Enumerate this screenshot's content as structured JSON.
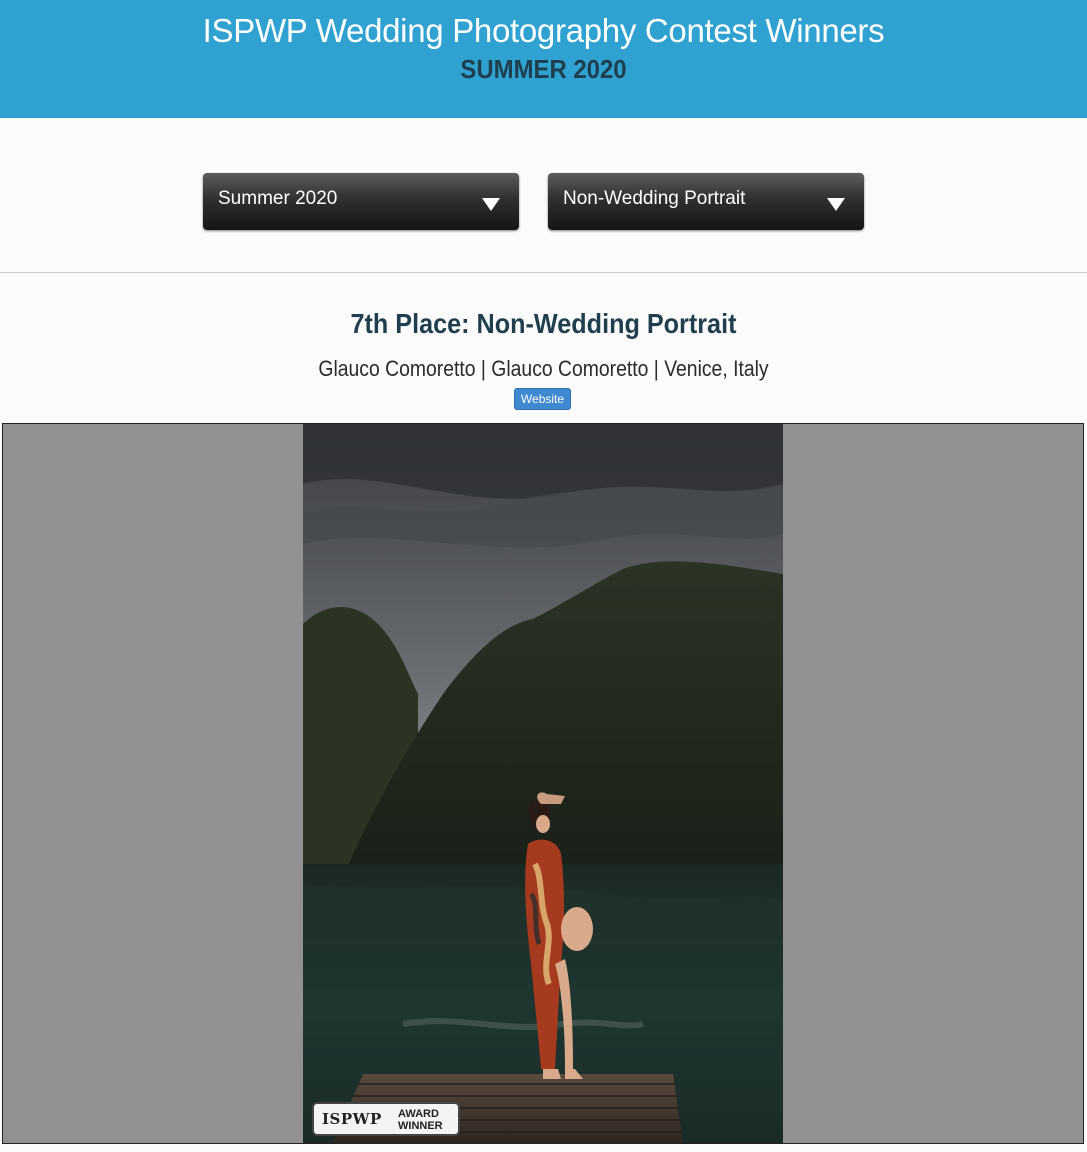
{
  "header": {
    "title": "ISPWP Wedding Photography Contest Winners",
    "subtitle": "SUMMER 2020",
    "background": "#2fa2d1",
    "subtitle_color": "#1f3f4e"
  },
  "filters": {
    "season": {
      "selected": "Summer 2020",
      "icon": "dropdown-arrow-icon"
    },
    "category": {
      "selected": "Non-Wedding Portrait",
      "icon": "dropdown-arrow-icon"
    }
  },
  "entry": {
    "title": "7th Place: Non-Wedding Portrait",
    "credit": "Glauco Comoretto | Glauco Comoretto | Venice, Italy",
    "website_label": "Website",
    "website_button_color": "#3e89d0"
  },
  "photo": {
    "badge": {
      "brand": "ISPWP",
      "line1": "AWARD",
      "line2": "WINNER"
    },
    "viewer_background": "#929192"
  }
}
